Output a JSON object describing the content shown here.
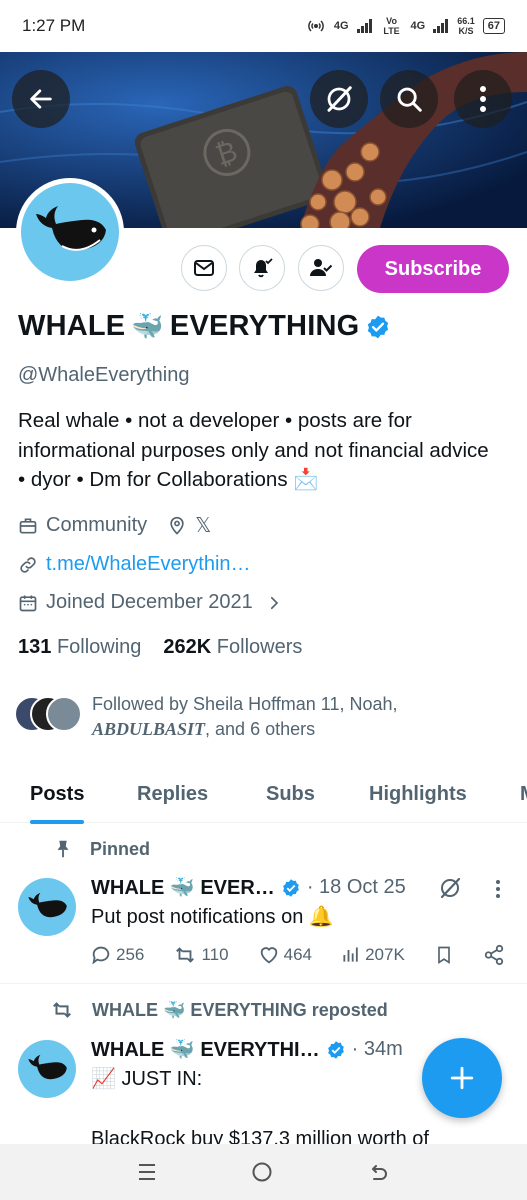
{
  "status_bar": {
    "time": "1:27 PM",
    "net1_label": "4G",
    "volte_label": "Vo LTE",
    "net2_label": "4G",
    "speed": "66.1",
    "speed_unit": "K/S",
    "battery": "67"
  },
  "header": {
    "back_icon": "arrow-left-icon",
    "grok_icon": "grok-icon",
    "search_icon": "search-icon",
    "more_icon": "more-vertical-icon"
  },
  "profile": {
    "name_part1": "WHALE",
    "name_emoji": "🐳",
    "name_part2": "EVERYTHING",
    "handle": "@WhaleEverything",
    "bio": "Real whale • not a developer • posts are for informational purposes only and not financial advice • dyor • Dm for Collaborations 📩",
    "category": "Community",
    "location": "𝕏",
    "link": "t.me/WhaleEverythin…",
    "joined": "Joined December 2021",
    "following_count": "131",
    "following_label": "Following",
    "followers_count": "262K",
    "followers_label": "Followers",
    "followed_by_prefix": "Followed by Sheila Hoffman 11, Noah, ",
    "followed_by_styled": "ABDULBASIT",
    "followed_by_suffix": ", and 6 others",
    "subscribe_label": "Subscribe",
    "verified_color": "#1d9bf0"
  },
  "tabs": [
    {
      "label": "Posts",
      "active": true
    },
    {
      "label": "Replies",
      "active": false
    },
    {
      "label": "Subs",
      "active": false
    },
    {
      "label": "Highlights",
      "active": false
    },
    {
      "label": "M",
      "active": false
    }
  ],
  "posts": [
    {
      "context": "Pinned",
      "name": "WHALE 🐳 EVER…",
      "time": "· 18 Oct 25",
      "text": "Put post notifications on 🔔",
      "replies": "256",
      "reposts": "110",
      "likes": "464",
      "views": "207K"
    },
    {
      "context": "WHALE 🐳 EVERYTHING reposted",
      "name": "WHALE 🐳 EVERYTHI…",
      "time": "· 34m",
      "text": "📈 JUST IN:",
      "text2": "BlackRock buy $137.3 million worth of"
    }
  ],
  "colors": {
    "accent": "#1d9bf0",
    "subscribe": "#c936c8",
    "secondary_text": "#536471",
    "avatar_bg": "#6cc7ee"
  }
}
